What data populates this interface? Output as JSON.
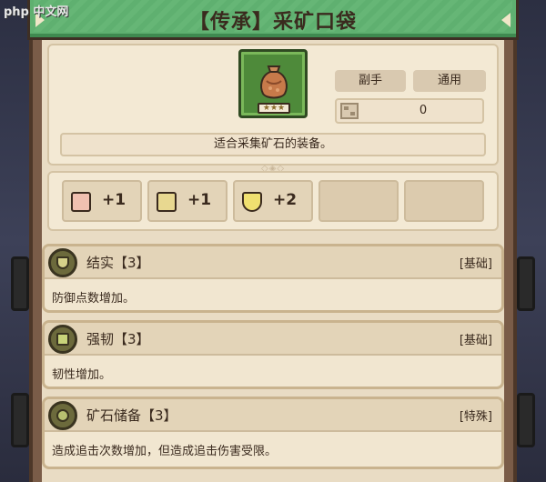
{
  "watermark": "php 中文网",
  "header": {
    "title": "【传承】采矿口袋"
  },
  "item": {
    "icon": "coin-pouch-icon",
    "stars": "★★★",
    "tags": [
      "副手",
      "通用"
    ],
    "value": "0",
    "description": "适合采集矿石的装备。"
  },
  "stats": [
    {
      "icon": "ore-icon",
      "value": "+1"
    },
    {
      "icon": "scroll-icon",
      "value": "+1"
    },
    {
      "icon": "shield-icon",
      "value": "+2"
    }
  ],
  "skills": [
    {
      "icon": "shield-badge-icon",
      "name": "结实【3】",
      "type": "[基础]",
      "description": "防御点数增加。"
    },
    {
      "icon": "fist-badge-icon",
      "name": "强韧【3】",
      "type": "[基础]",
      "description": "韧性增加。"
    },
    {
      "icon": "ore-badge-icon",
      "name": "矿石储备【3】",
      "type": "[特殊]",
      "description": "造成追击次数增加，但造成追击伤害受限。"
    }
  ],
  "colors": {
    "header_green": "#5fb070",
    "panel_brown": "#7a5c48",
    "card_bg": "#f3e9d4",
    "text_dark": "#3a2a1e"
  }
}
